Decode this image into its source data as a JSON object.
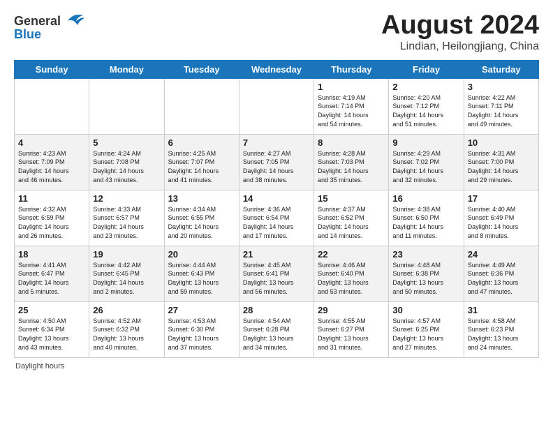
{
  "header": {
    "logo_text_general": "General",
    "logo_text_blue": "Blue",
    "month_title": "August 2024",
    "location": "Lindian, Heilongjiang, China"
  },
  "weekdays": [
    "Sunday",
    "Monday",
    "Tuesday",
    "Wednesday",
    "Thursday",
    "Friday",
    "Saturday"
  ],
  "weeks": [
    [
      {
        "day": "",
        "info": ""
      },
      {
        "day": "",
        "info": ""
      },
      {
        "day": "",
        "info": ""
      },
      {
        "day": "",
        "info": ""
      },
      {
        "day": "1",
        "info": "Sunrise: 4:19 AM\nSunset: 7:14 PM\nDaylight: 14 hours\nand 54 minutes."
      },
      {
        "day": "2",
        "info": "Sunrise: 4:20 AM\nSunset: 7:12 PM\nDaylight: 14 hours\nand 51 minutes."
      },
      {
        "day": "3",
        "info": "Sunrise: 4:22 AM\nSunset: 7:11 PM\nDaylight: 14 hours\nand 49 minutes."
      }
    ],
    [
      {
        "day": "4",
        "info": "Sunrise: 4:23 AM\nSunset: 7:09 PM\nDaylight: 14 hours\nand 46 minutes."
      },
      {
        "day": "5",
        "info": "Sunrise: 4:24 AM\nSunset: 7:08 PM\nDaylight: 14 hours\nand 43 minutes."
      },
      {
        "day": "6",
        "info": "Sunrise: 4:25 AM\nSunset: 7:07 PM\nDaylight: 14 hours\nand 41 minutes."
      },
      {
        "day": "7",
        "info": "Sunrise: 4:27 AM\nSunset: 7:05 PM\nDaylight: 14 hours\nand 38 minutes."
      },
      {
        "day": "8",
        "info": "Sunrise: 4:28 AM\nSunset: 7:03 PM\nDaylight: 14 hours\nand 35 minutes."
      },
      {
        "day": "9",
        "info": "Sunrise: 4:29 AM\nSunset: 7:02 PM\nDaylight: 14 hours\nand 32 minutes."
      },
      {
        "day": "10",
        "info": "Sunrise: 4:31 AM\nSunset: 7:00 PM\nDaylight: 14 hours\nand 29 minutes."
      }
    ],
    [
      {
        "day": "11",
        "info": "Sunrise: 4:32 AM\nSunset: 6:59 PM\nDaylight: 14 hours\nand 26 minutes."
      },
      {
        "day": "12",
        "info": "Sunrise: 4:33 AM\nSunset: 6:57 PM\nDaylight: 14 hours\nand 23 minutes."
      },
      {
        "day": "13",
        "info": "Sunrise: 4:34 AM\nSunset: 6:55 PM\nDaylight: 14 hours\nand 20 minutes."
      },
      {
        "day": "14",
        "info": "Sunrise: 4:36 AM\nSunset: 6:54 PM\nDaylight: 14 hours\nand 17 minutes."
      },
      {
        "day": "15",
        "info": "Sunrise: 4:37 AM\nSunset: 6:52 PM\nDaylight: 14 hours\nand 14 minutes."
      },
      {
        "day": "16",
        "info": "Sunrise: 4:38 AM\nSunset: 6:50 PM\nDaylight: 14 hours\nand 11 minutes."
      },
      {
        "day": "17",
        "info": "Sunrise: 4:40 AM\nSunset: 6:49 PM\nDaylight: 14 hours\nand 8 minutes."
      }
    ],
    [
      {
        "day": "18",
        "info": "Sunrise: 4:41 AM\nSunset: 6:47 PM\nDaylight: 14 hours\nand 5 minutes."
      },
      {
        "day": "19",
        "info": "Sunrise: 4:42 AM\nSunset: 6:45 PM\nDaylight: 14 hours\nand 2 minutes."
      },
      {
        "day": "20",
        "info": "Sunrise: 4:44 AM\nSunset: 6:43 PM\nDaylight: 13 hours\nand 59 minutes."
      },
      {
        "day": "21",
        "info": "Sunrise: 4:45 AM\nSunset: 6:41 PM\nDaylight: 13 hours\nand 56 minutes."
      },
      {
        "day": "22",
        "info": "Sunrise: 4:46 AM\nSunset: 6:40 PM\nDaylight: 13 hours\nand 53 minutes."
      },
      {
        "day": "23",
        "info": "Sunrise: 4:48 AM\nSunset: 6:38 PM\nDaylight: 13 hours\nand 50 minutes."
      },
      {
        "day": "24",
        "info": "Sunrise: 4:49 AM\nSunset: 6:36 PM\nDaylight: 13 hours\nand 47 minutes."
      }
    ],
    [
      {
        "day": "25",
        "info": "Sunrise: 4:50 AM\nSunset: 6:34 PM\nDaylight: 13 hours\nand 43 minutes."
      },
      {
        "day": "26",
        "info": "Sunrise: 4:52 AM\nSunset: 6:32 PM\nDaylight: 13 hours\nand 40 minutes."
      },
      {
        "day": "27",
        "info": "Sunrise: 4:53 AM\nSunset: 6:30 PM\nDaylight: 13 hours\nand 37 minutes."
      },
      {
        "day": "28",
        "info": "Sunrise: 4:54 AM\nSunset: 6:28 PM\nDaylight: 13 hours\nand 34 minutes."
      },
      {
        "day": "29",
        "info": "Sunrise: 4:55 AM\nSunset: 6:27 PM\nDaylight: 13 hours\nand 31 minutes."
      },
      {
        "day": "30",
        "info": "Sunrise: 4:57 AM\nSunset: 6:25 PM\nDaylight: 13 hours\nand 27 minutes."
      },
      {
        "day": "31",
        "info": "Sunrise: 4:58 AM\nSunset: 6:23 PM\nDaylight: 13 hours\nand 24 minutes."
      }
    ]
  ],
  "footer": {
    "daylight_hours_label": "Daylight hours"
  }
}
